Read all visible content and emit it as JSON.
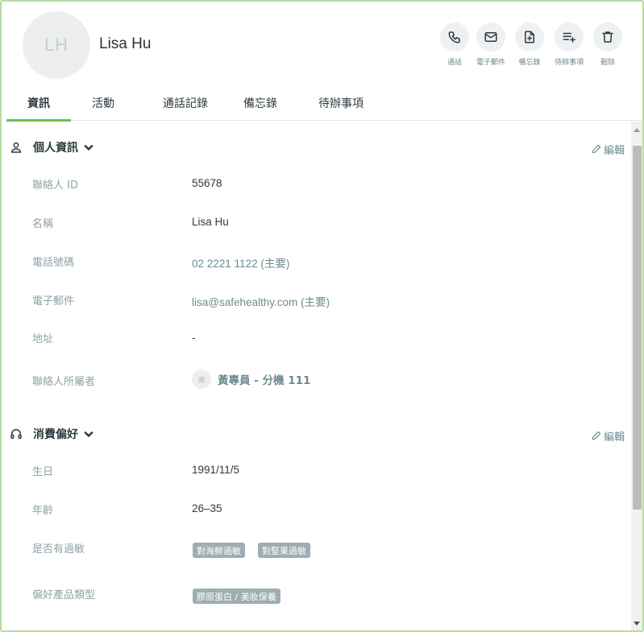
{
  "header": {
    "avatar_initials": "LH",
    "name": "Lisa Hu",
    "actions": [
      {
        "label": "通話",
        "icon": "phone-icon"
      },
      {
        "label": "電子郵件",
        "icon": "mail-icon"
      },
      {
        "label": "備忘錄",
        "icon": "note-add-icon"
      },
      {
        "label": "待辦事項",
        "icon": "playlist-add-icon"
      },
      {
        "label": "刪除",
        "icon": "trash-icon"
      }
    ]
  },
  "tabs": [
    {
      "label": "資訊",
      "active": true
    },
    {
      "label": "活動",
      "active": false
    },
    {
      "label": "通話記錄",
      "active": false
    },
    {
      "label": "備忘錄",
      "active": false
    },
    {
      "label": "待辦事項",
      "active": false
    }
  ],
  "personal": {
    "title": "個人資訊",
    "edit_label": "編輯",
    "fields": [
      {
        "label": "聯絡人 ID",
        "value": "55678"
      },
      {
        "label": "名稱",
        "value": "Lisa Hu"
      },
      {
        "label": "電話號碼",
        "value": "02 2221 1122 (主要)"
      },
      {
        "label": "電子郵件",
        "value": "lisa@safehealthy.com (主要)"
      },
      {
        "label": "地址",
        "value": "-"
      },
      {
        "label": "聯絡人所屬者",
        "value": "黃專員 - 分機 111",
        "avatar": "黃"
      }
    ]
  },
  "preferences": {
    "title": "消費偏好",
    "edit_label": "編輯",
    "fields": [
      {
        "label": "生日",
        "value": "1991/11/5"
      },
      {
        "label": "年齡",
        "value": "26–35"
      },
      {
        "label": "是否有過敏",
        "tags": [
          "對海鮮過敏",
          "對堅果過敏"
        ]
      },
      {
        "label": "偏好產品類型",
        "tags": [
          "膠原蛋白 / 美妝保養"
        ]
      }
    ]
  },
  "colors": {
    "accent": "#6ac24a",
    "muted_text": "#8fa2a8",
    "link_text": "#6d8a92",
    "tag_bg": "#9eadb2",
    "frame_border": "#b9dca3"
  }
}
